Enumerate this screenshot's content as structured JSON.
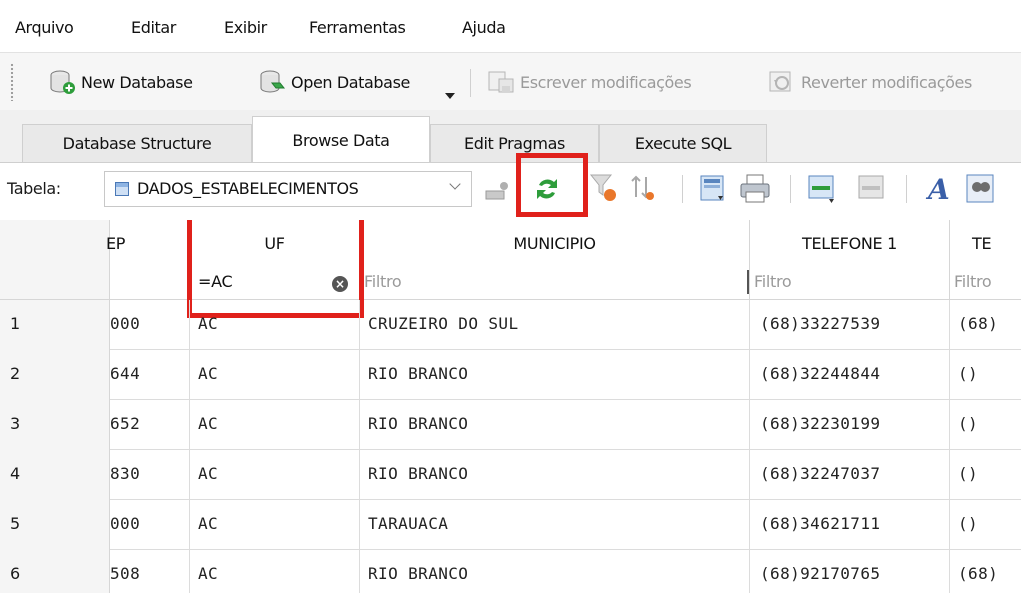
{
  "menu": [
    "Arquivo",
    "Editar",
    "Exibir",
    "Ferramentas",
    "Ajuda"
  ],
  "toolbar": {
    "new_database": "New Database",
    "open_database": "Open Database",
    "write_changes": "Escrever modificações",
    "revert_changes": "Reverter modificações"
  },
  "tabs": [
    "Database Structure",
    "Browse Data",
    "Edit Pragmas",
    "Execute SQL"
  ],
  "active_tab": "Browse Data",
  "filterbar": {
    "table_label": "Tabela:",
    "table_name": "DADOS_ESTABELECIMENTOS"
  },
  "grid": {
    "columns": [
      "EP",
      "UF",
      "MUNICIPIO",
      "TELEFONE 1",
      "TE"
    ],
    "filters": [
      "",
      "=AC",
      "Filtro",
      "Filtro",
      "Filtro"
    ],
    "rows": [
      {
        "n": "1",
        "cells": [
          "000",
          "AC",
          "CRUZEIRO DO SUL",
          "(68)33227539",
          "(68)"
        ]
      },
      {
        "n": "2",
        "cells": [
          "644",
          "AC",
          "RIO BRANCO",
          "(68)32244844",
          "()"
        ]
      },
      {
        "n": "3",
        "cells": [
          "652",
          "AC",
          "RIO BRANCO",
          "(68)32230199",
          "()"
        ]
      },
      {
        "n": "4",
        "cells": [
          "830",
          "AC",
          "RIO BRANCO",
          "(68)32247037",
          "()"
        ]
      },
      {
        "n": "5",
        "cells": [
          "000",
          "AC",
          "TARAUACA",
          "(68)34621711",
          "()"
        ]
      },
      {
        "n": "6",
        "cells": [
          "508",
          "AC",
          "RIO BRANCO",
          "(68)92170765",
          "(68)"
        ]
      }
    ]
  },
  "colors": {
    "highlight": "#e0211b",
    "refresh_icon": "#2e9d3b"
  }
}
